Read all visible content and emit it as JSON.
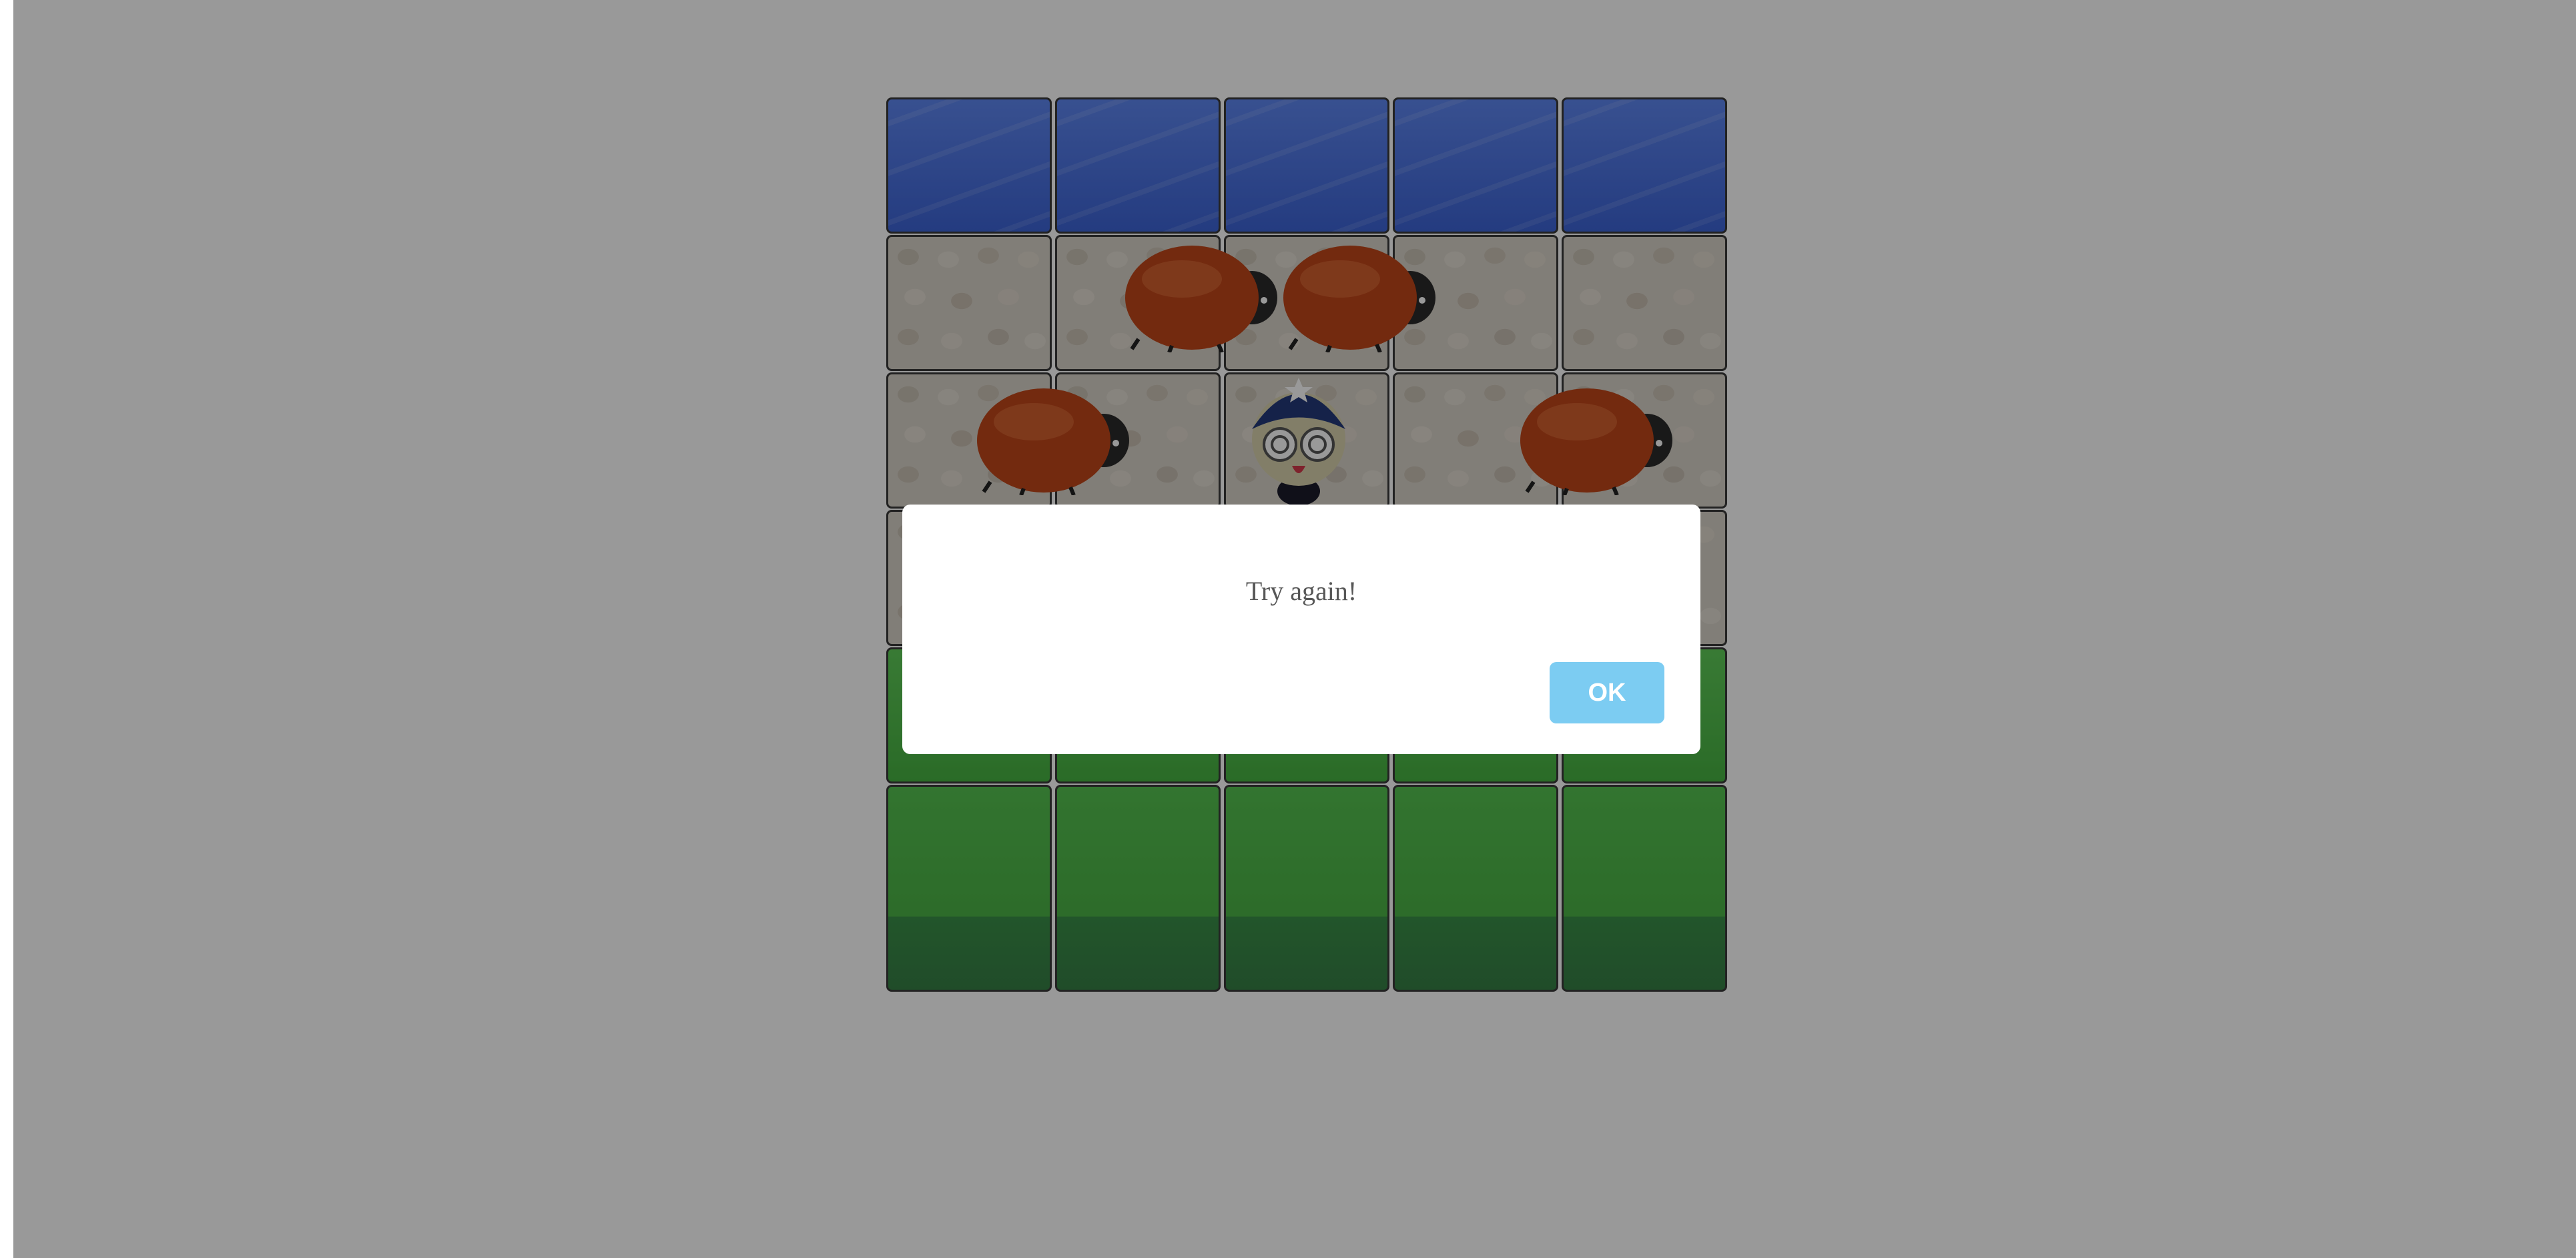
{
  "game": {
    "rows": [
      [
        "water",
        "water",
        "water",
        "water",
        "water"
      ],
      [
        "stone",
        "stone",
        "stone",
        "stone",
        "stone"
      ],
      [
        "stone",
        "stone",
        "stone",
        "stone",
        "stone"
      ],
      [
        "stone",
        "stone",
        "stone",
        "stone",
        "stone"
      ],
      [
        "grass",
        "grass",
        "grass",
        "grass",
        "grass"
      ],
      [
        "grass",
        "grass",
        "grass",
        "grass",
        "grass"
      ]
    ],
    "enemies": [
      {
        "type": "ladybug",
        "row": 1,
        "col": 1.9,
        "facing": "right"
      },
      {
        "type": "ladybug",
        "row": 1,
        "col": 2.8,
        "facing": "right"
      },
      {
        "type": "ladybug",
        "row": 2,
        "col": 1.0,
        "facing": "right"
      },
      {
        "type": "ladybug",
        "row": 2,
        "col": 4.2,
        "facing": "right"
      }
    ],
    "player": {
      "character": "boy-with-star-hat",
      "row": 2,
      "col": 2,
      "state": "dizzy"
    }
  },
  "dialog": {
    "message": "Try again!",
    "ok_label": "OK"
  },
  "colors": {
    "overlay": "rgba(0,0,0,0.40)",
    "button_bg": "#7cccf2",
    "message_text": "#575757"
  }
}
